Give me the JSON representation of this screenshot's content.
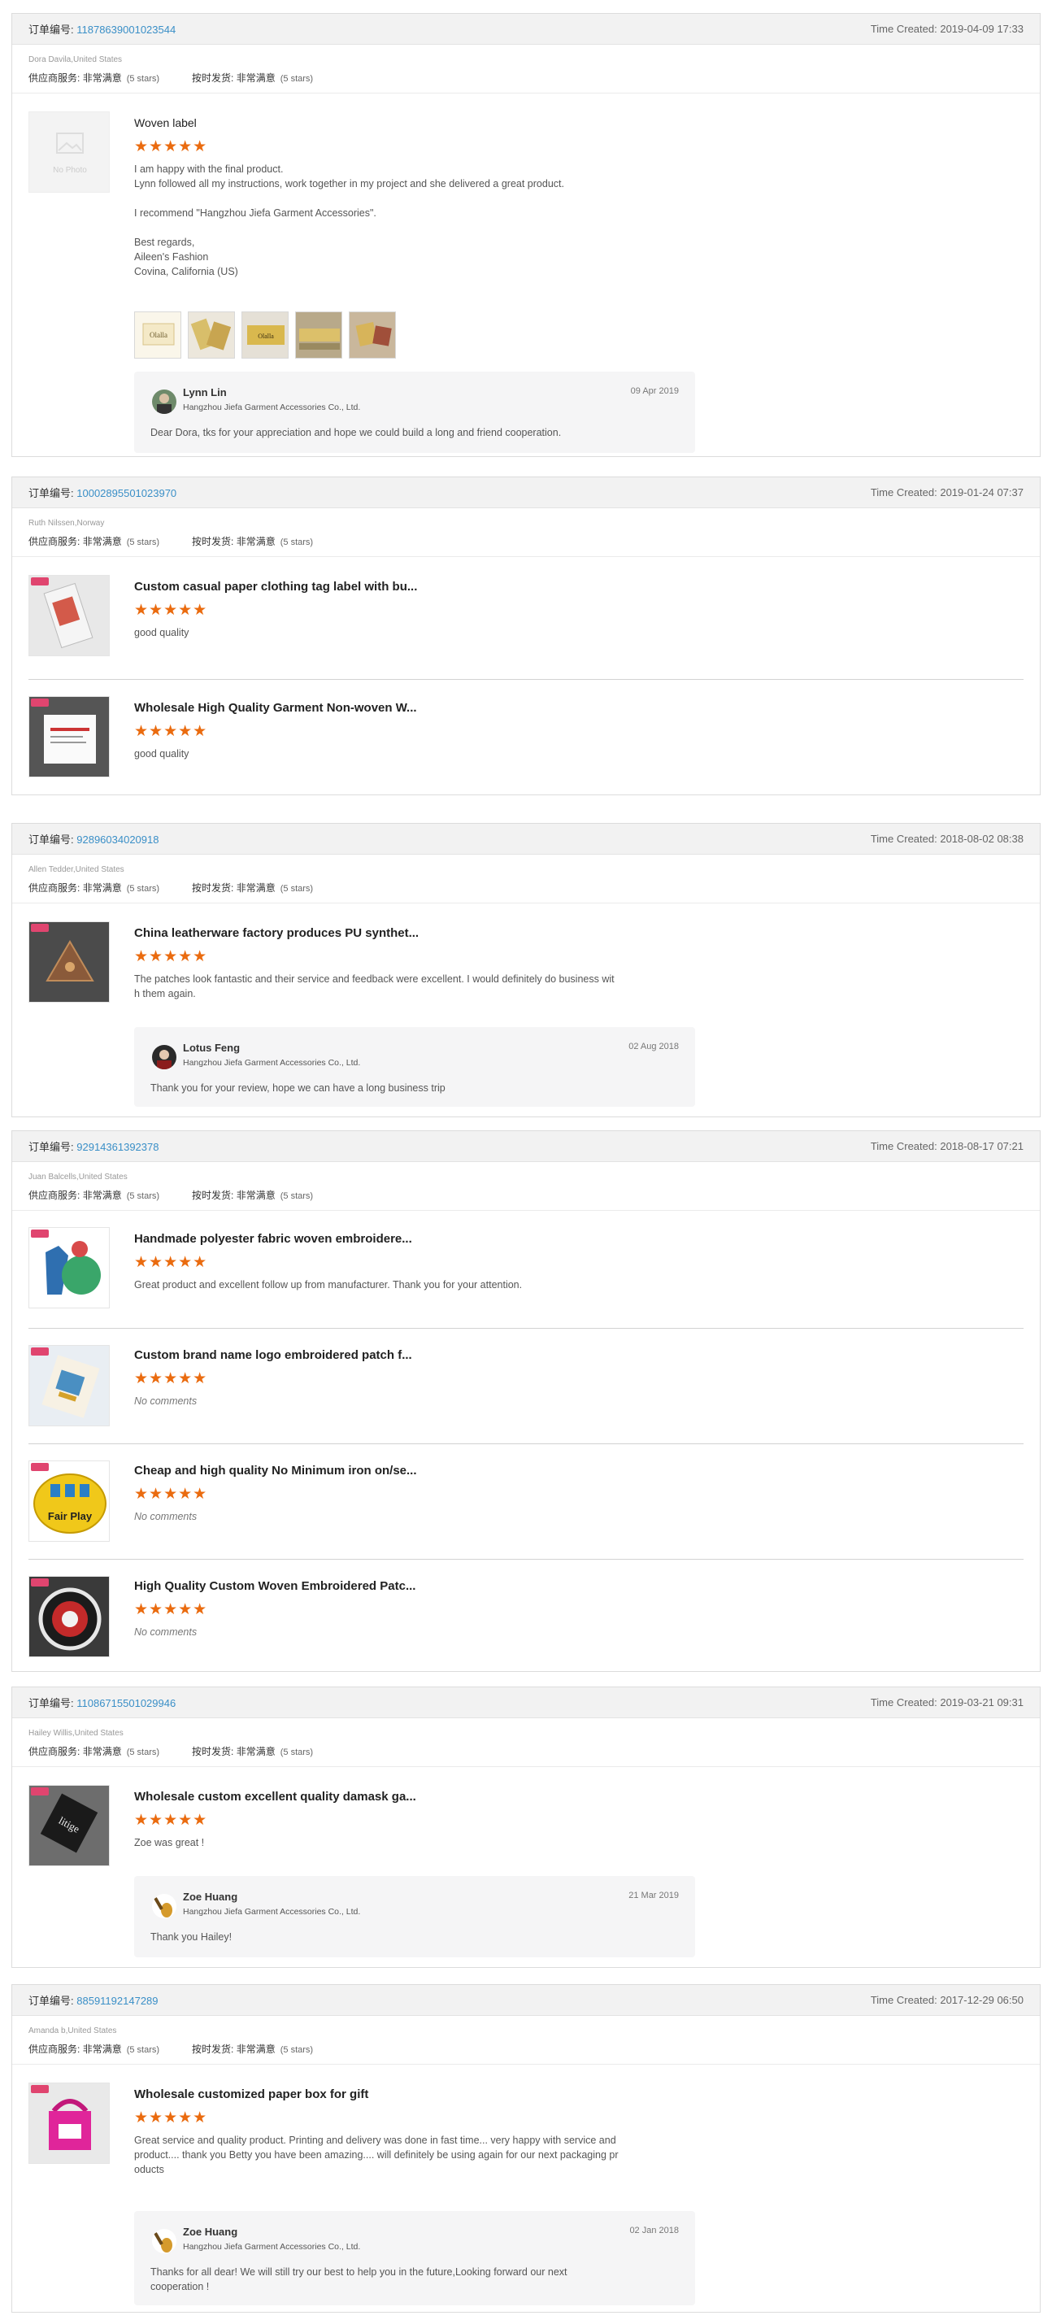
{
  "labels": {
    "order_no": "订单编号:",
    "supplier_service": "供应商服务:",
    "on_time": "按时发货:",
    "very_satisfied": "非常满意",
    "five_stars": "(5 stars)",
    "time_created": "Time Created:",
    "no_photo": "No Photo",
    "stars": "★★★★★",
    "company": "Hangzhou Jiefa Garment Accessories Co., Ltd."
  },
  "colors": {
    "accent_link": "#3a8fc7",
    "star": "#ea6b0f",
    "header_bg": "#f2f2f2",
    "reply_bg": "#f5f5f6"
  },
  "orders": [
    {
      "order_no": "11878639001023544",
      "time": "2019-04-09 17:33",
      "buyer": "Dora Davila,United States",
      "items": [
        {
          "title": "Woven label",
          "comment": "I am happy with the final product.\nLynn followed all my instructions, work together in my project and she delivered a great product.\n\nI recommend \"Hangzhou Jiefa Garment Accessories\".\n\nBest regards,\nAileen's Fashion\nCovina, California (US)",
          "thumb_texts": [
            "Olalla",
            "",
            "Olalla",
            "",
            ""
          ]
        }
      ],
      "reply": {
        "name": "Lynn Lin",
        "date": "09 Apr 2019",
        "text": "Dear Dora, tks for your appreciation and hope we could build a long and friend cooperation."
      }
    },
    {
      "order_no": "10002895501023970",
      "time": "2019-01-24 07:37",
      "buyer": "Ruth Nilssen,Norway",
      "items": [
        {
          "title": "Custom casual paper clothing tag label with bu...",
          "comment": "good quality"
        },
        {
          "title": "Wholesale High Quality Garment Non-woven W...",
          "comment": "good quality"
        }
      ]
    },
    {
      "order_no": "92896034020918",
      "time": "2018-08-02 08:38",
      "buyer": "Allen Tedder,United States",
      "items": [
        {
          "title": "China leatherware factory produces PU synthet...",
          "comment": "The patches look fantastic and their service and feedback were excellent. I would definitely do business wit\nh them again."
        }
      ],
      "reply": {
        "name": "Lotus Feng",
        "date": "02 Aug 2018",
        "text": "Thank you for your review, hope we can have a long business trip"
      }
    },
    {
      "order_no": "92914361392378",
      "time": "2018-08-17 07:21",
      "buyer": "Juan Balcells,United States",
      "items": [
        {
          "title": "Handmade polyester fabric woven embroidere...",
          "comment": "Great product and excellent follow up from manufacturer. Thank you for your attention."
        },
        {
          "title": "Custom brand name logo embroidered patch f...",
          "comment": "No comments",
          "nocmt": true
        },
        {
          "title": "Cheap and high quality No Minimum iron on/se...",
          "comment": "No comments",
          "nocmt": true,
          "img_text": "Fair Play"
        },
        {
          "title": "High Quality Custom Woven Embroidered Patc...",
          "comment": "No comments",
          "nocmt": true
        }
      ]
    },
    {
      "order_no": "11086715501029946",
      "time": "2019-03-21 09:31",
      "buyer": "Hailey Willis,United States",
      "items": [
        {
          "title": "Wholesale custom excellent quality damask ga...",
          "comment": "Zoe was great !",
          "img_text": "litige"
        }
      ],
      "reply": {
        "name": "Zoe Huang",
        "date": "21 Mar 2019",
        "text": "Thank you Hailey!"
      }
    },
    {
      "order_no": "88591192147289",
      "time": "2017-12-29 06:50",
      "buyer": "Amanda b,United States",
      "items": [
        {
          "title": "Wholesale customized paper box for gift",
          "comment": "Great service and quality product. Printing and delivery was done in fast time... very happy with service and\nproduct.... thank you Betty you have been amazing.... will definitely be using again for our next packaging pr\noducts"
        }
      ],
      "reply": {
        "name": "Zoe Huang",
        "date": "02 Jan 2018",
        "text": "Thanks for all dear! We will still try our best to help you in the future,Looking forward our next\ncooperation !"
      }
    }
  ]
}
